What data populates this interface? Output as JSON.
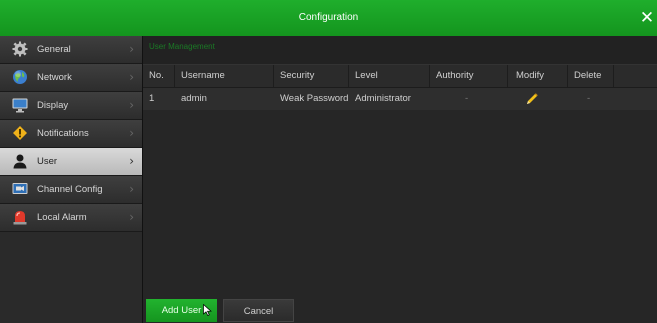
{
  "window": {
    "title": "Configuration",
    "close_icon": "close-icon"
  },
  "sidebar": {
    "items": [
      {
        "label": "General",
        "icon": "gear-icon",
        "active": false
      },
      {
        "label": "Network",
        "icon": "globe-icon",
        "active": false
      },
      {
        "label": "Display",
        "icon": "monitor-icon",
        "active": false
      },
      {
        "label": "Notifications",
        "icon": "warning-icon",
        "active": false
      },
      {
        "label": "User",
        "icon": "user-icon",
        "active": true
      },
      {
        "label": "Channel Config",
        "icon": "camera-screen-icon",
        "active": false
      },
      {
        "label": "Local Alarm",
        "icon": "alarm-light-icon",
        "active": false
      }
    ],
    "chevron": "›"
  },
  "content": {
    "section_title": "User Management",
    "table": {
      "columns": [
        "No.",
        "Username",
        "Security",
        "Level",
        "Authority",
        "Modify",
        "Delete"
      ],
      "rows": [
        {
          "no": "1",
          "username": "admin",
          "security": "Weak Password",
          "level": "Administrator",
          "authority": "-",
          "modify_icon": "pencil-icon",
          "delete": "-"
        }
      ]
    }
  },
  "footer": {
    "add_label": "Add User",
    "cancel_label": "Cancel"
  },
  "colors": {
    "accent": "#18a024",
    "titlebar": "#14951e",
    "background": "#222222"
  }
}
